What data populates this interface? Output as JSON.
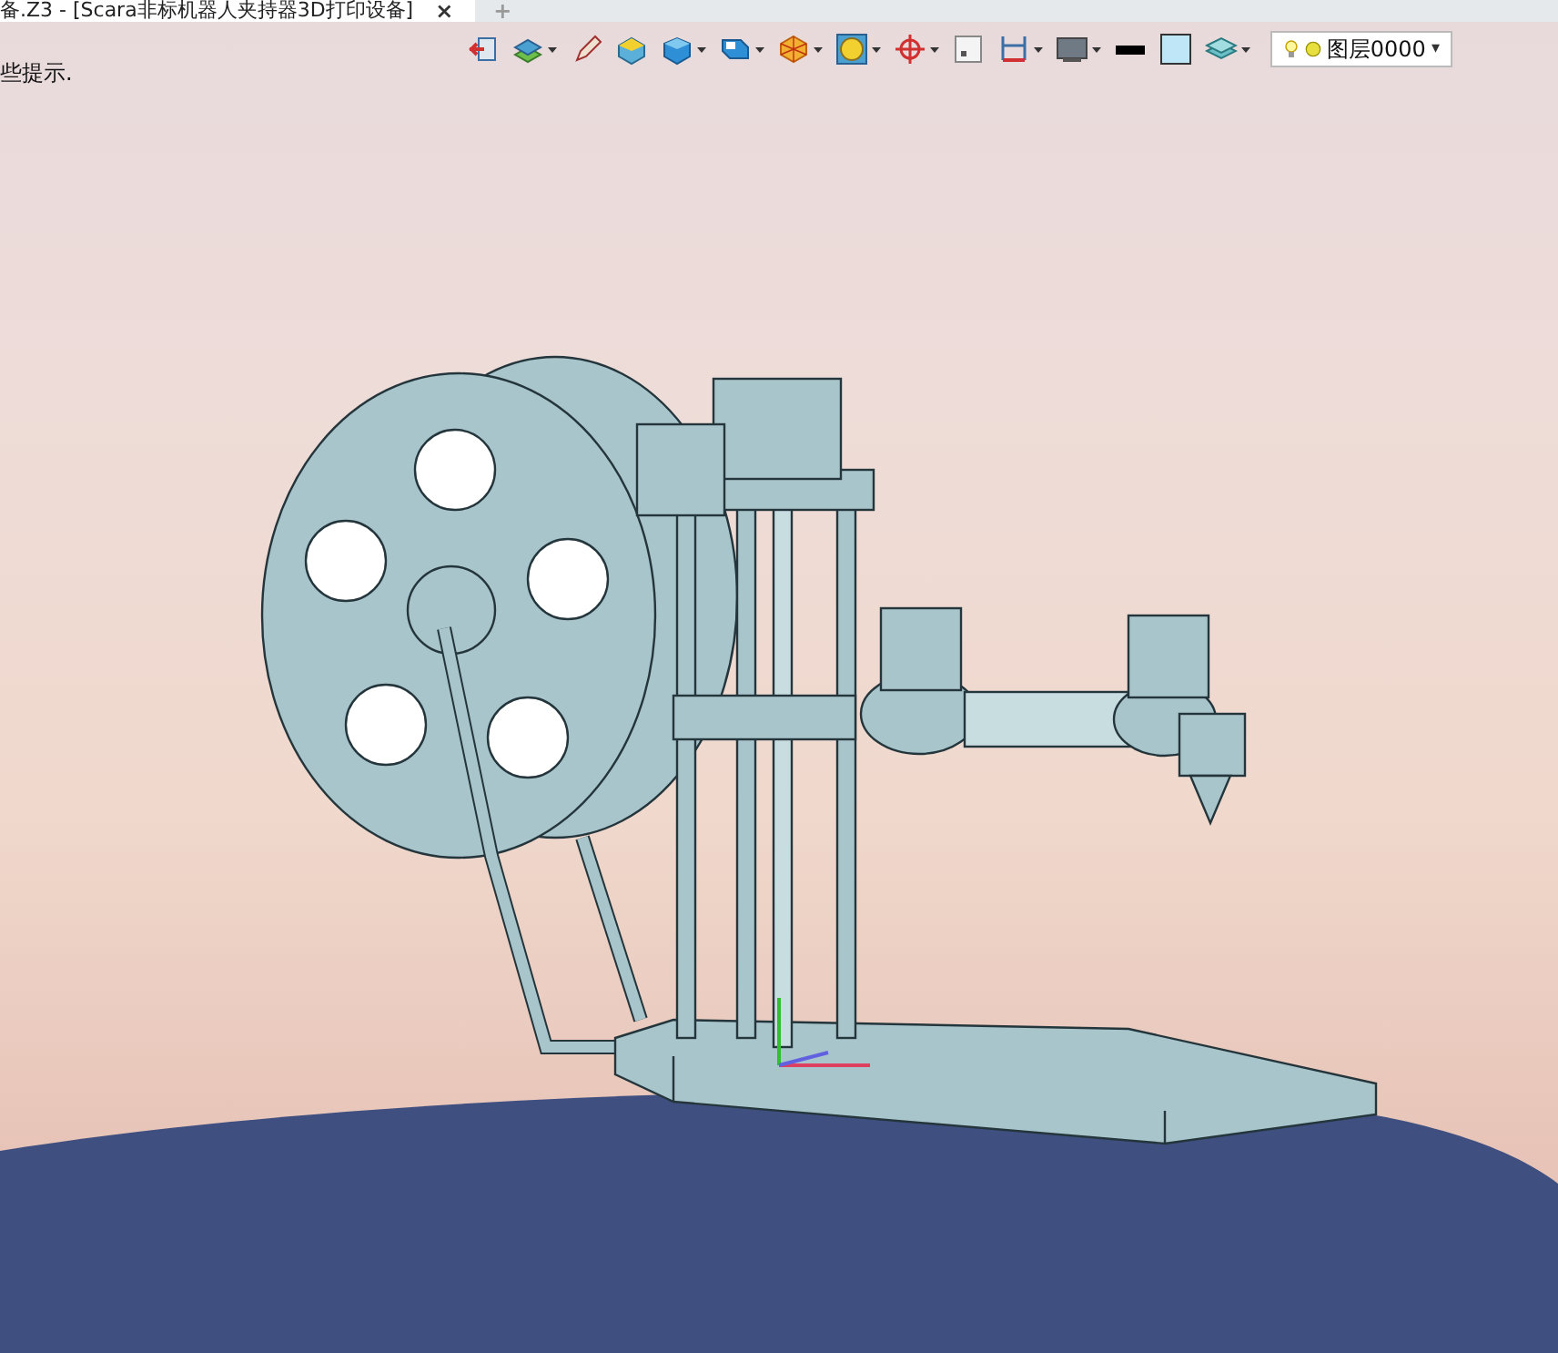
{
  "title_tab": {
    "title": "备.Z3 - [Scara非标机器人夹持器3D打印设备]",
    "close": "×",
    "new_tab": "+"
  },
  "hint": "些提示.",
  "toolbar": [
    {
      "menu": false
    },
    {
      "menu": true
    },
    {
      "menu": false
    },
    {
      "menu": false
    },
    {
      "menu": true
    },
    {
      "menu": true
    },
    {
      "menu": true
    },
    {
      "menu": true
    },
    {
      "menu": true
    },
    {
      "menu": false
    },
    {
      "menu": true
    },
    {
      "menu": true
    },
    {
      "menu": false
    },
    {
      "menu": false
    },
    {
      "menu": true
    }
  ],
  "layer_combo": {
    "value": "图层0000",
    "caret": "▾"
  }
}
